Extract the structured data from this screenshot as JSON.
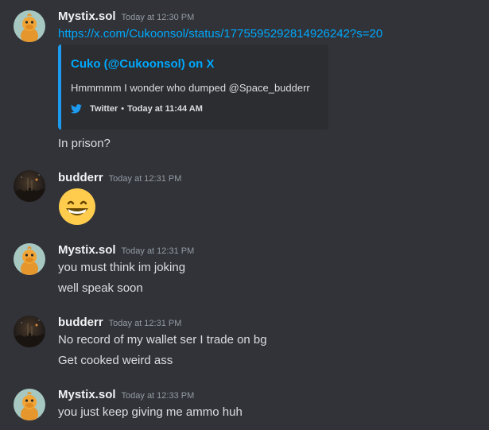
{
  "messages": [
    {
      "author": "Mystix.sol",
      "timestamp": "Today at 12:30 PM",
      "avatar": "duck-avatar",
      "link": "https://x.com/Cukoonsol/status/1775595292814926242?s=20",
      "embed": {
        "title": "Cuko (@Cukoonsol) on X",
        "description": "Hmmmmm I wonder who dumped @Space_budderr",
        "footer_source": "Twitter",
        "footer_time": "Today at 11:44 AM",
        "accent_color": "#1d9bf0",
        "icon": "twitter-bird-icon"
      },
      "lines": [
        "In prison?"
      ]
    },
    {
      "author": "budderr",
      "timestamp": "Today at 12:31 PM",
      "avatar": "night-sky-avatar",
      "emoji": "grinning-face-emoji"
    },
    {
      "author": "Mystix.sol",
      "timestamp": "Today at 12:31 PM",
      "avatar": "duck-avatar",
      "lines": [
        "you must think im joking",
        "well speak soon"
      ]
    },
    {
      "author": "budderr",
      "timestamp": "Today at 12:31 PM",
      "avatar": "night-sky-avatar",
      "lines": [
        "No record of my wallet ser I trade on bg",
        "Get cooked weird ass"
      ]
    },
    {
      "author": "Mystix.sol",
      "timestamp": "Today at 12:33 PM",
      "avatar": "duck-avatar",
      "lines": [
        "you just keep giving me ammo huh"
      ]
    }
  ],
  "colors": {
    "background": "#313338",
    "username": "#f2f3f5",
    "message_text": "#dbdee1",
    "timestamp": "#949ba4",
    "link": "#00a8fc",
    "embed_background": "#2b2d31"
  }
}
